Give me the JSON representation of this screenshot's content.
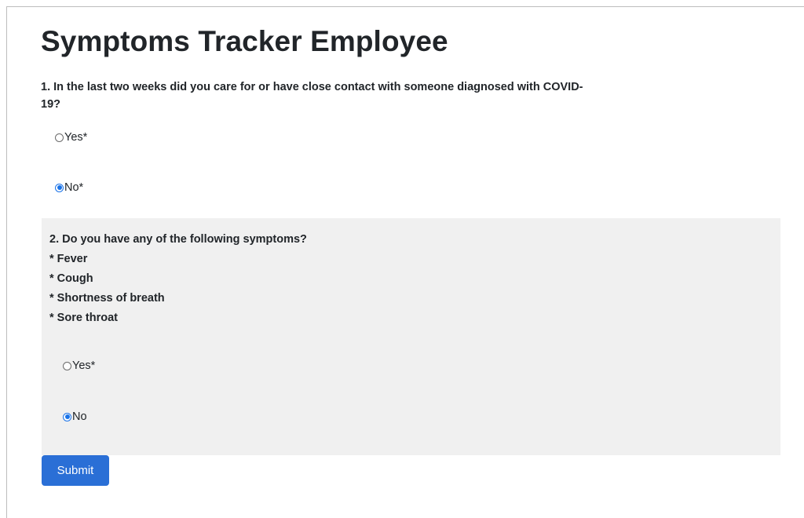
{
  "page": {
    "title": "Symptoms Tracker Employee"
  },
  "question1": {
    "text": "1. In the last two weeks did you care for or have close contact with someone diagnosed with COVID-19?",
    "options": [
      {
        "label": "Yes*",
        "checked": false
      },
      {
        "label": "No*",
        "checked": true
      }
    ]
  },
  "question2": {
    "text": "2. Do you have any of the following symptoms?",
    "symptoms": [
      "* Fever",
      "* Cough",
      "* Shortness of breath",
      "* Sore throat"
    ],
    "options": [
      {
        "label": "Yes*",
        "checked": false
      },
      {
        "label": "No",
        "checked": true
      }
    ]
  },
  "form": {
    "submit_label": "Submit"
  },
  "colors": {
    "accent": "#1a73e8",
    "button": "#2a6fd6",
    "panel_bg": "#f0f0f0"
  }
}
